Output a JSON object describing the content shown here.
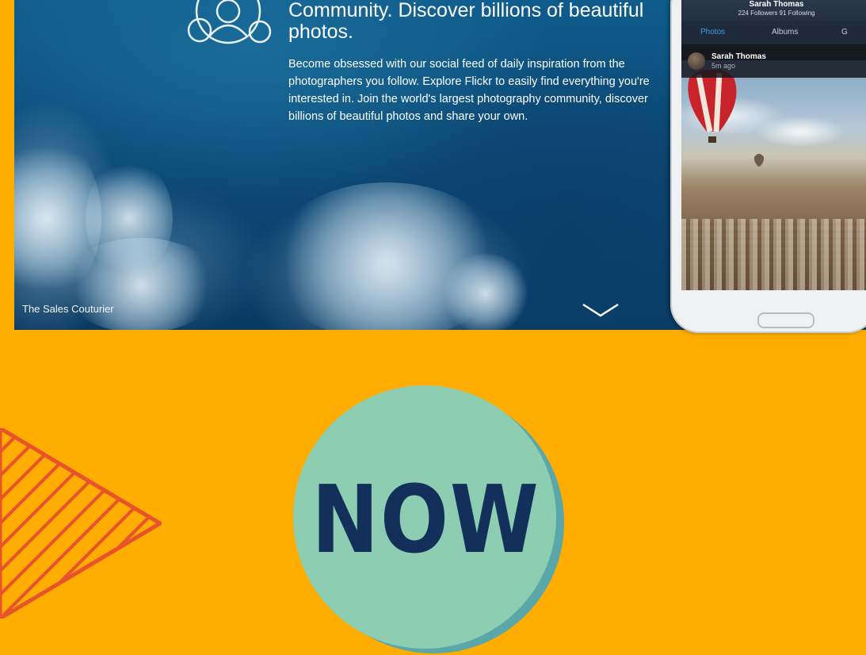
{
  "hero": {
    "headline": "Community. Discover billions of beautiful photos.",
    "body": "Become obsessed with our social feed of daily inspiration from the photographers you follow. Explore Flickr to easily find everything you're interested in. Join the world's largest photography community, discover billions of beautiful photos and share your own.",
    "photo_credit": "The Sales Couturier",
    "icons": {
      "community": "community-icon",
      "scroll": "chevron-down-icon"
    }
  },
  "phone": {
    "profile_name": "Sarah Thomas",
    "profile_stats": "224 Followers 91 Following",
    "tabs": [
      "Photos",
      "Albums",
      "G"
    ],
    "active_tab": "Photos",
    "post": {
      "author": "Sarah Thomas",
      "time": "5m ago"
    }
  },
  "badge": {
    "label": "NOW"
  },
  "colors": {
    "background": "#FFAD01",
    "badge_fill": "#8DCDB2",
    "badge_shadow": "#5AA7A9",
    "badge_text": "#12305A",
    "arrow_stripes": "#E8532B",
    "tab_active": "#3aa0e8"
  }
}
